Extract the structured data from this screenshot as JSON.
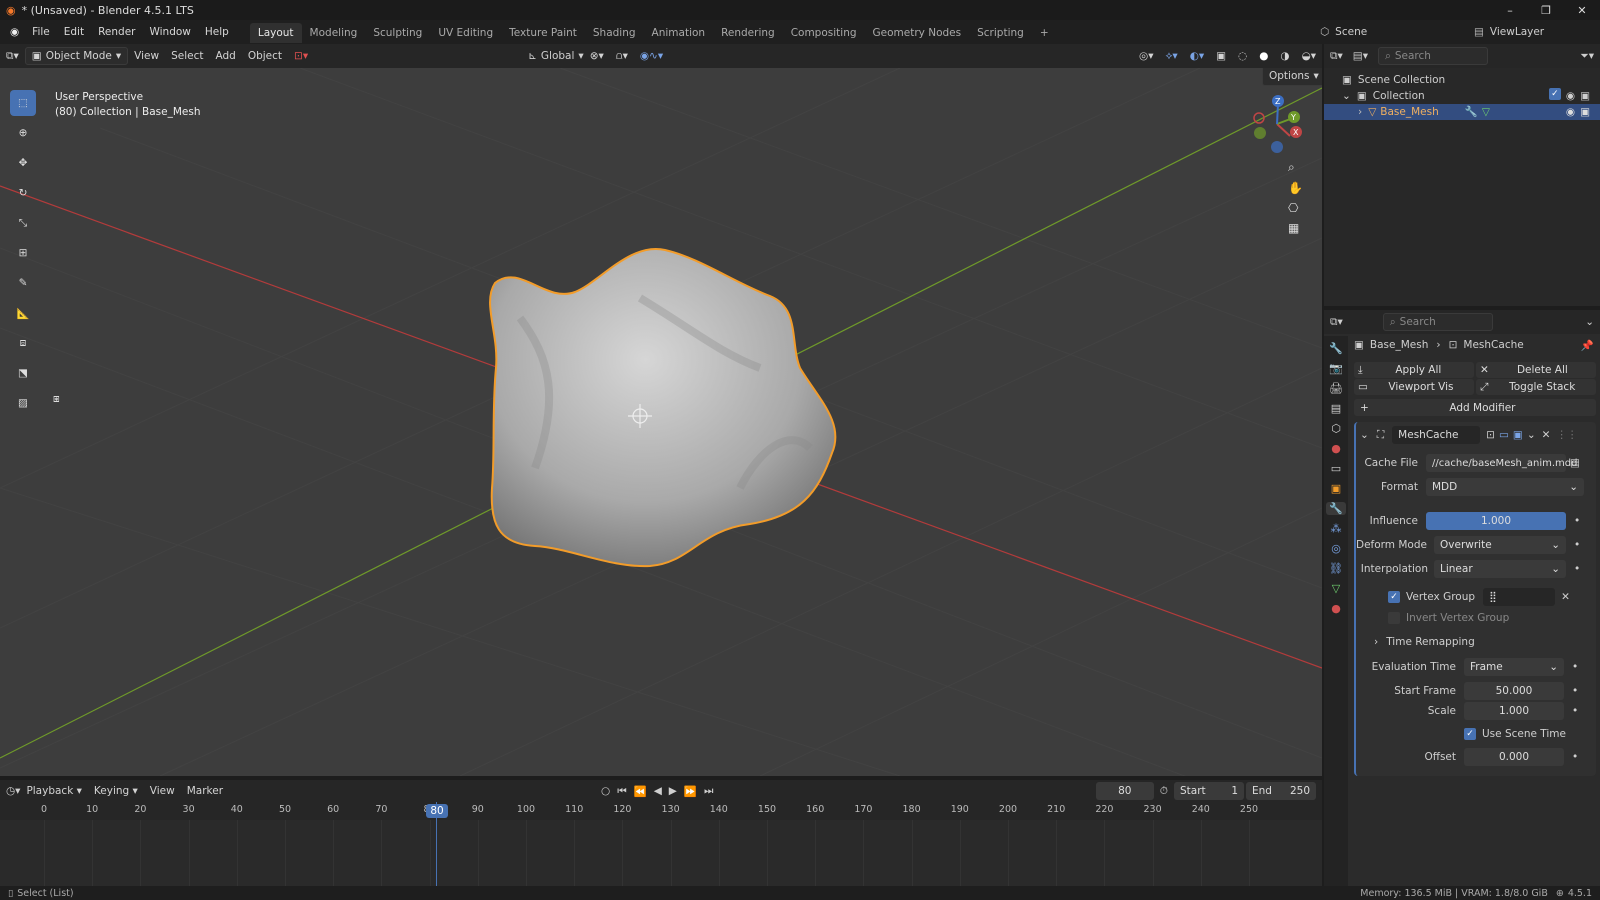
{
  "title": {
    "text": "* (Unsaved) - Blender 4.5.1 LTS",
    "minimize": "–",
    "maximize": "❐",
    "close": "✕"
  },
  "menu": [
    "File",
    "Edit",
    "Render",
    "Window",
    "Help"
  ],
  "workspaces": [
    "Layout",
    "Modeling",
    "Sculpting",
    "UV Editing",
    "Texture Paint",
    "Shading",
    "Animation",
    "Rendering",
    "Compositing",
    "Geometry Nodes",
    "Scripting"
  ],
  "topright": {
    "scene": "Scene",
    "viewlayer": "ViewLayer"
  },
  "viewport_header": {
    "mode": "Object Mode",
    "view": "View",
    "select": "Select",
    "add": "Add",
    "object": "Object",
    "orientation": "Global",
    "options": "Options"
  },
  "viewport": {
    "perspective": "User Perspective",
    "collection": "(80) Collection | Base_Mesh",
    "gizmo_x": "X",
    "gizmo_y": "Y",
    "gizmo_z": "Z"
  },
  "outliner": {
    "search_placeholder": "Search",
    "scene_collection": "Scene Collection",
    "collection": "Collection",
    "object": "Base_Mesh"
  },
  "properties": {
    "search_placeholder": "Search",
    "breadcrumb_object": "Base_Mesh",
    "breadcrumb_modifier": "MeshCache",
    "apply_all": "Apply All",
    "delete_all": "Delete All",
    "viewport_vis": "Viewport Vis",
    "toggle_stack": "Toggle Stack",
    "add_modifier": "Add Modifier",
    "modifier_name": "MeshCache",
    "cache_file_label": "Cache File",
    "cache_file": "//cache/baseMesh_anim.mdd",
    "format_label": "Format",
    "format": "MDD",
    "influence_label": "Influence",
    "influence": "1.000",
    "deform_mode_label": "Deform Mode",
    "deform_mode": "Overwrite",
    "interpolation_label": "Interpolation",
    "interpolation": "Linear",
    "vertex_group_label": "Vertex Group",
    "invert_vertex_group": "Invert Vertex Group",
    "time_remapping": "Time Remapping",
    "evaluation_time_label": "Evaluation Time",
    "evaluation_time": "Frame",
    "start_frame_label": "Start Frame",
    "start_frame": "50.000",
    "scale_label": "Scale",
    "scale": "1.000",
    "use_scene_time": "Use Scene Time",
    "offset_label": "Offset",
    "offset": "0.000"
  },
  "timeline": {
    "playback": "Playback",
    "keying": "Keying",
    "view": "View",
    "marker": "Marker",
    "current_frame": "80",
    "start_label": "Start",
    "start": "1",
    "end_label": "End",
    "end": "250",
    "ticks": [
      "0",
      "10",
      "20",
      "30",
      "40",
      "50",
      "60",
      "70",
      "80",
      "90",
      "100",
      "110",
      "120",
      "130",
      "140",
      "150",
      "160",
      "170",
      "180",
      "190",
      "200",
      "210",
      "220",
      "230",
      "240",
      "250"
    ]
  },
  "status": {
    "left": "Select (List)",
    "right": "Memory: 136.5 MiB | VRAM: 1.8/8.0 GiB",
    "version": "4.5.1"
  },
  "colors": {
    "accent": "#4772b3",
    "selection_outline": "#f29c2a",
    "x_axis": "#b33b3b",
    "y_axis": "#6f9a2a"
  }
}
